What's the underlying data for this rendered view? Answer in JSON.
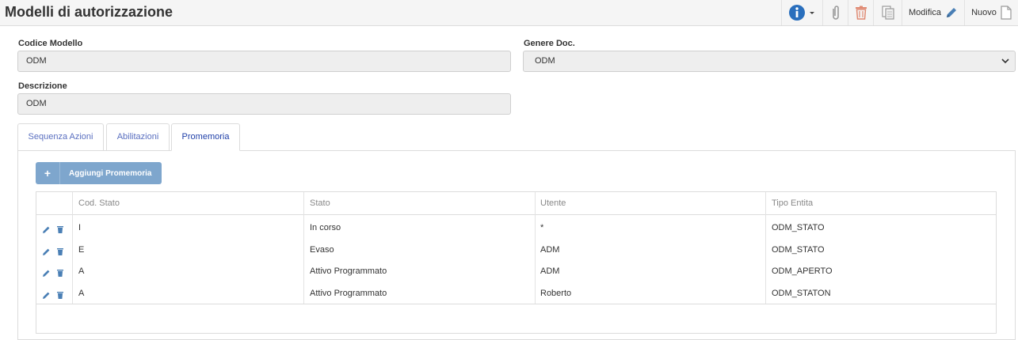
{
  "header": {
    "title": "Modelli di autorizzazione",
    "toolbar": {
      "info_icon": "info-icon",
      "attach_icon": "paperclip-icon",
      "delete_icon": "trash-icon",
      "copy_icon": "copy-icon",
      "modify_label": "Modifica",
      "new_label": "Nuovo"
    }
  },
  "form": {
    "codice_label": "Codice Modello",
    "codice_value": "ODM",
    "genere_label": "Genere Doc.",
    "genere_value": "ODM",
    "descrizione_label": "Descrizione",
    "descrizione_value": "ODM"
  },
  "tabs": [
    {
      "label": "Sequenza Azioni",
      "active": false
    },
    {
      "label": "Abilitazioni",
      "active": false
    },
    {
      "label": "Promemoria",
      "active": true
    }
  ],
  "add_button": {
    "label": "Aggiungi Promemoria"
  },
  "table": {
    "columns": [
      "Cod. Stato",
      "Stato",
      "Utente",
      "Tipo Entita"
    ],
    "rows": [
      [
        "I",
        "In corso",
        "*",
        "ODM_STATO"
      ],
      [
        "E",
        "Evaso",
        "ADM",
        "ODM_STATO"
      ],
      [
        "A",
        "Attivo Programmato",
        "ADM",
        "ODM_APERTO"
      ],
      [
        "A",
        "Attivo Programmato",
        "Roberto",
        "ODM_STATON"
      ]
    ]
  },
  "colors": {
    "accent": "#1f3fa8",
    "button": "#7ea6cd",
    "info": "#2a6fbd",
    "delete": "#e08a73",
    "edit_icon": "#4a7fb5"
  }
}
